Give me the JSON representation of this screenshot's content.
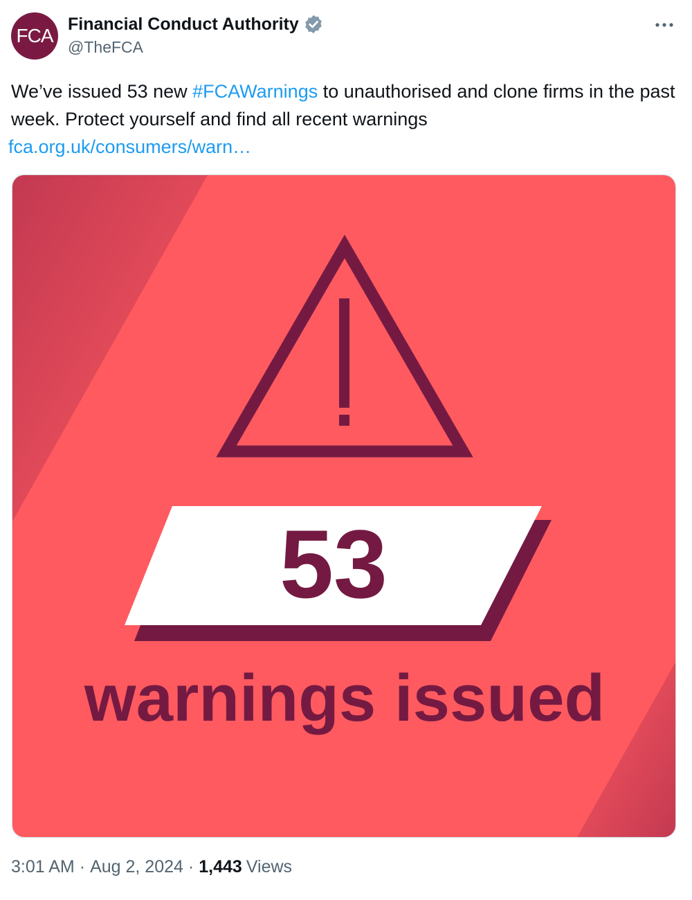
{
  "account": {
    "avatar_text": "FCA",
    "display_name": "Financial Conduct Authority",
    "handle": "@TheFCA",
    "verified_color": "#829aab"
  },
  "tweet": {
    "text_part1": "We’ve issued 53 new ",
    "hashtag": "#FCAWarnings",
    "text_part2": " to unauthorised and clone firms in the past week. Protect yourself and find all recent warnings",
    "link": "fca.org.uk/consumers/warn…"
  },
  "media": {
    "number": "53",
    "caption": "warnings issued",
    "background_color": "#ff5a5f",
    "accent_color": "#741a42",
    "icon": "warning-triangle-icon"
  },
  "meta": {
    "time": "3:01 AM",
    "separator": "·",
    "date": "Aug 2, 2024",
    "views_count": "1,443",
    "views_label": "Views"
  }
}
